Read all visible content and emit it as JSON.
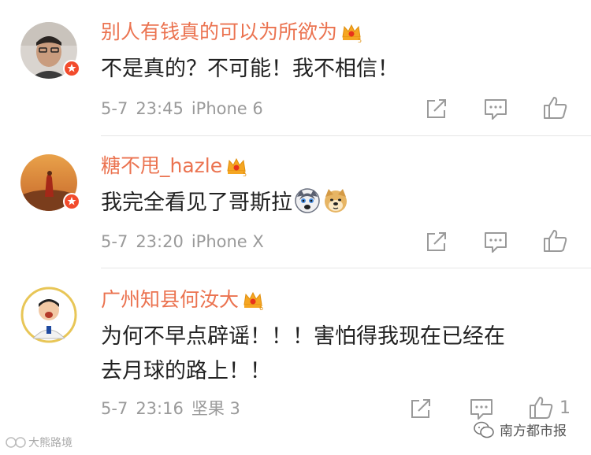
{
  "comments": [
    {
      "username": "别人有钱真的可以为所欲为",
      "text": "不是真的？不可能！我不相信！",
      "date": "5-7",
      "time": "23:45",
      "device": "iPhone 6",
      "like_count": ""
    },
    {
      "username": "糖不甩_hazle",
      "text": "我完全看见了哥斯拉",
      "date": "5-7",
      "time": "23:20",
      "device": "iPhone X",
      "like_count": ""
    },
    {
      "username": "广州知县何汝大",
      "text_line1": "为何不早点辟谣！！！害怕得我现在已经在",
      "text_line2": "去月球的路上！！",
      "date": "5-7",
      "time": "23:16",
      "device": "坚果 3",
      "like_count": "1"
    }
  ],
  "watermark_left": "大熊路境",
  "watermark_right": "南方都市报",
  "colors": {
    "username": "#eb7350",
    "text": "#222222",
    "meta": "#9a9a9a",
    "verified": "#f24b2c"
  }
}
